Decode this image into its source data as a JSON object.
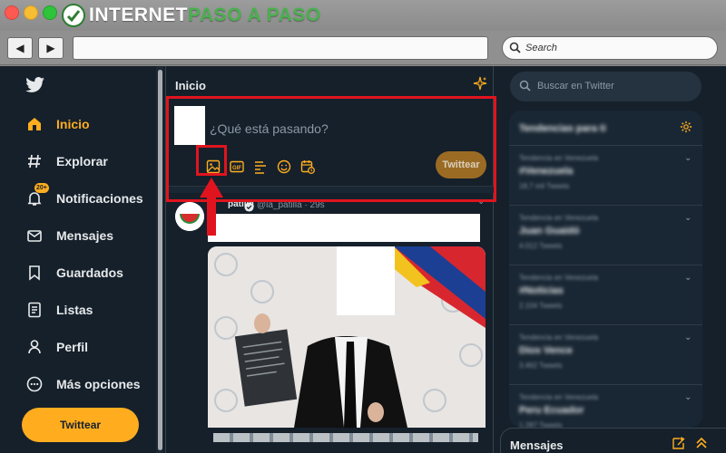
{
  "brand": {
    "internet": "INTERNET",
    "paso_a_paso": "PASO A PASO"
  },
  "browser": {
    "back_label": "◀",
    "forward_label": "▶",
    "search_placeholder": "Search"
  },
  "sidebar": {
    "items": [
      {
        "label": "Inicio",
        "icon": "home-icon",
        "active": true
      },
      {
        "label": "Explorar",
        "icon": "hashtag-icon"
      },
      {
        "label": "Notificaciones",
        "icon": "bell-icon",
        "badge": "20+"
      },
      {
        "label": "Mensajes",
        "icon": "envelope-icon"
      },
      {
        "label": "Guardados",
        "icon": "bookmark-icon"
      },
      {
        "label": "Listas",
        "icon": "list-icon"
      },
      {
        "label": "Perfil",
        "icon": "person-icon"
      },
      {
        "label": "Más opciones",
        "icon": "more-icon"
      }
    ],
    "tweet_button": "Twittear"
  },
  "main": {
    "title": "Inicio",
    "composer": {
      "placeholder": "¿Qué está pasando?",
      "tweet_button": "Twittear",
      "toolbar_icons": [
        "image-icon",
        "gif-icon",
        "poll-icon",
        "emoji-icon",
        "schedule-icon"
      ]
    },
    "tweet": {
      "name": "patilla",
      "handle": "@la_patilla · 29s"
    }
  },
  "right": {
    "search_placeholder": "Buscar en Twitter",
    "trends_title": "Tendencias para ti",
    "trends": [
      {
        "meta": "Tendencia en Venezuela",
        "name": "#Venezuela",
        "count": "18,7 mil Tweets"
      },
      {
        "meta": "Tendencia en Venezuela",
        "name": "Juan Guaidó",
        "count": "4.012 Tweets"
      },
      {
        "meta": "Tendencia en Venezuela",
        "name": "#Noticias",
        "count": "2.104 Tweets"
      },
      {
        "meta": "Tendencia en Venezuela",
        "name": "Dios Vence",
        "count": "3.462 Tweets"
      },
      {
        "meta": "Tendencia en Venezuela",
        "name": "Peru Ecuador",
        "count": "1.287 Tweets"
      }
    ],
    "messages_title": "Mensajes"
  },
  "colors": {
    "background": "#15202b",
    "accent": "#ffad1f",
    "highlight": "#e0141e"
  }
}
